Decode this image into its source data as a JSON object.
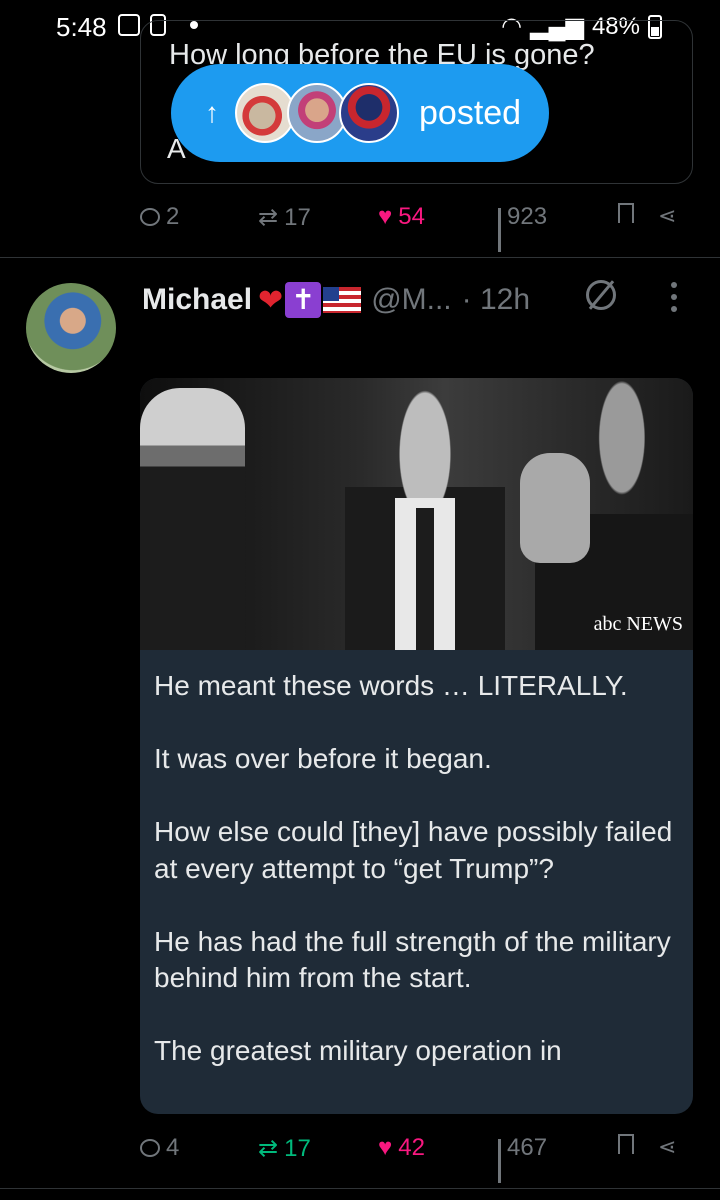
{
  "status_bar": {
    "time": "5:48",
    "battery": "48%"
  },
  "prev_tweet": {
    "text_partial": "How long before the EU is gone?",
    "text_fragment": "A"
  },
  "posted_pill": {
    "label": "posted",
    "arrow": "↑"
  },
  "prev_actions": {
    "replies": "2",
    "retweets": "17",
    "likes": "54",
    "views": "923"
  },
  "tweet": {
    "author_name": "Michael",
    "handle": "@M...",
    "time": "· 12h",
    "cross_emoji": "✝",
    "video_watermark": "abc NEWS",
    "text_paragraphs": [
      "He meant these words … LITERALLY.",
      "It was over before it began.",
      "How else could [they] have possibly failed at every attempt to “get Trump”?",
      "He has had the full strength of the military behind him from the start.",
      "The greatest military operation in"
    ]
  },
  "tweet_actions": {
    "replies": "4",
    "retweets": "17",
    "likes": "42",
    "views": "467"
  },
  "colors": {
    "background": "#000000",
    "accent_blue": "#1d9bf0",
    "like_pink": "#f91880",
    "retweet_green": "#00ba7c",
    "muted": "#71767b",
    "card_bg": "#1f2b37"
  }
}
